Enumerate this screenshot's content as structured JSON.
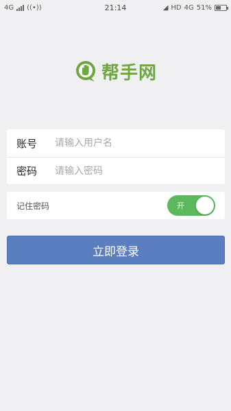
{
  "status_bar": {
    "network_left": "4G",
    "time": "21:14",
    "hd": "HD",
    "network_right": "4G",
    "battery_percent": "51%",
    "battery_level": 0.51
  },
  "logo": {
    "text": "帮手网",
    "brand_color": "#6fa640"
  },
  "login_form": {
    "username_label": "账号",
    "username_placeholder": "请输入用户名",
    "username_value": "",
    "password_label": "密码",
    "password_placeholder": "请输入密码",
    "password_value": ""
  },
  "remember": {
    "label": "记住密码",
    "toggle_text": "开",
    "toggle_on": true,
    "toggle_color": "#5cb85c"
  },
  "login_button": {
    "label": "立即登录",
    "color": "#5a7ec0"
  }
}
